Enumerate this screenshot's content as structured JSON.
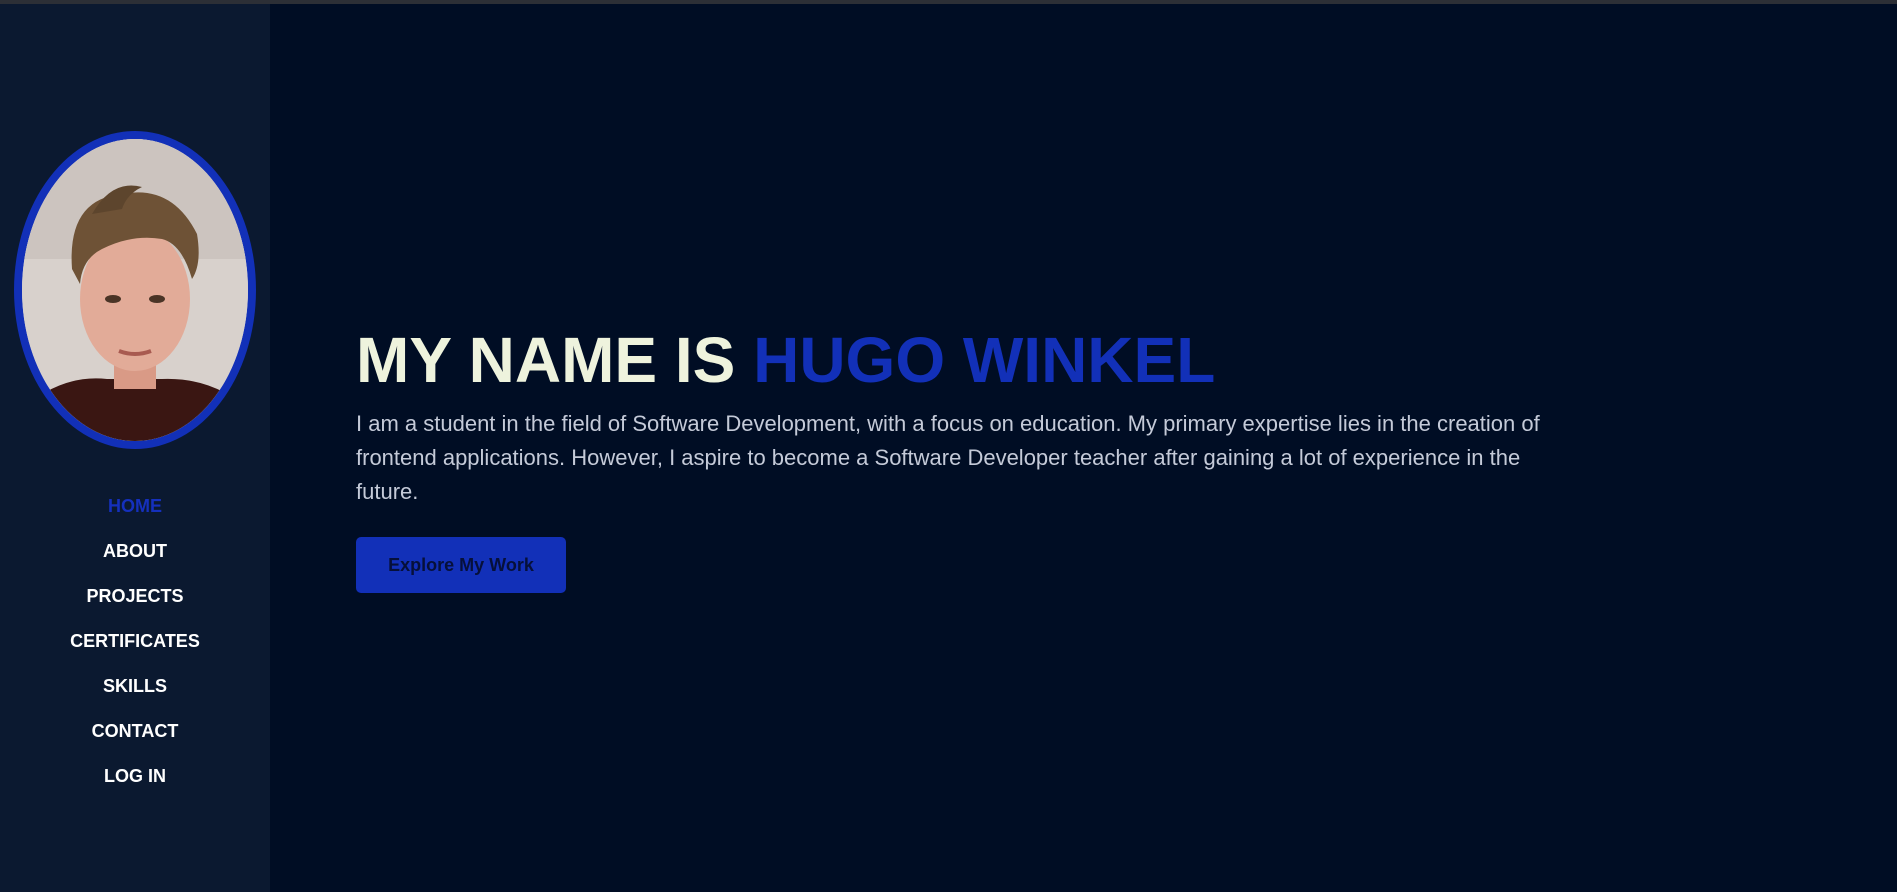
{
  "profile": {
    "photo_alt": "profile-photo"
  },
  "nav": {
    "items": [
      {
        "label": "HOME",
        "active": true
      },
      {
        "label": "ABOUT"
      },
      {
        "label": "PROJECTS"
      },
      {
        "label": "CERTIFICATES"
      },
      {
        "label": "SKILLS"
      },
      {
        "label": "CONTACT"
      },
      {
        "label": "LOG IN"
      }
    ]
  },
  "hero": {
    "title_prefix": "MY NAME IS ",
    "title_name": "HUGO WINKEL",
    "intro": "I am a student in the field of Software Development, with a focus on education. My primary expertise lies in the creation of frontend applications. However, I aspire to become a Software Developer teacher after gaining a lot of experience in the future.",
    "cta_label": "Explore My Work"
  },
  "colors": {
    "background": "#000d24",
    "sidebar": "#0b1930",
    "accent": "#1230b8",
    "title": "#eef3dd",
    "body_text": "#c4cad8"
  }
}
